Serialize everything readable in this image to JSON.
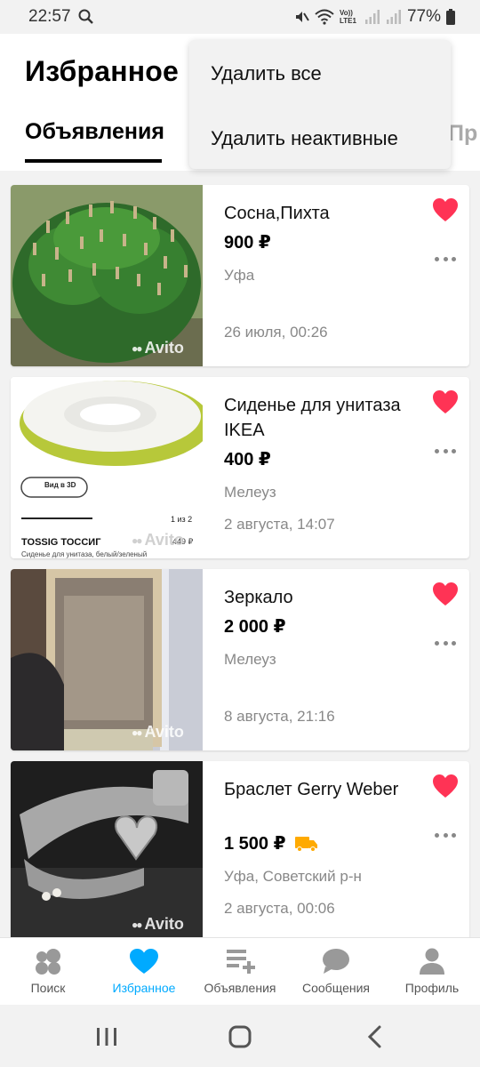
{
  "status_bar": {
    "time": "22:57",
    "battery": "77%",
    "lte_label": "Vo)) LTE1"
  },
  "header": {
    "title": "Избранное",
    "tab_active": "Объявления",
    "tab_partial": "Пр"
  },
  "menu": {
    "items": [
      "Удалить все",
      "Удалить неактивные"
    ]
  },
  "cards": [
    {
      "title": "Сосна,Пихта",
      "price": "900 ₽",
      "location": "Уфа",
      "date": "26 июля, 00:26",
      "image": "pine-tree-photo",
      "watermark": "Avito",
      "delivery": false
    },
    {
      "title": "Сиденье для унитаза IKEA",
      "price": "400 ₽",
      "location": "Мелеуз",
      "date": "2 августа, 14:07",
      "image": "toilet-seat-photo",
      "watermark": "Avito",
      "delivery": false,
      "image_texts": {
        "view3d": "Вид в 3D",
        "counter": "1 из 2",
        "brand": "TOSSIG ТОССИГ",
        "caption": "Сиденье для унитаза, белый/зеленый",
        "price_tag": "449 ₽"
      }
    },
    {
      "title": "Зеркало",
      "price": "2 000 ₽",
      "location": "Мелеуз",
      "date": "8 августа, 21:16",
      "image": "mirror-photo",
      "watermark": "Avito",
      "delivery": false
    },
    {
      "title": "Браслет Gerry Weber",
      "price": "1 500 ₽",
      "location": "Уфа, Советский р-н",
      "date": "2 августа, 00:06",
      "image": "bracelet-photo",
      "watermark": "Avito",
      "delivery": true
    }
  ],
  "bottom_nav": [
    {
      "label": "Поиск",
      "icon": "search-bubbles-icon",
      "active": false
    },
    {
      "label": "Избранное",
      "icon": "heart-icon",
      "active": true
    },
    {
      "label": "Объявления",
      "icon": "add-listing-icon",
      "active": false
    },
    {
      "label": "Сообщения",
      "icon": "chat-bubble-icon",
      "active": false
    },
    {
      "label": "Профиль",
      "icon": "person-icon",
      "active": false
    }
  ],
  "colors": {
    "favorite": "#ff3355",
    "accent": "#00aaff",
    "delivery": "#ffaa00",
    "muted": "#888888"
  }
}
